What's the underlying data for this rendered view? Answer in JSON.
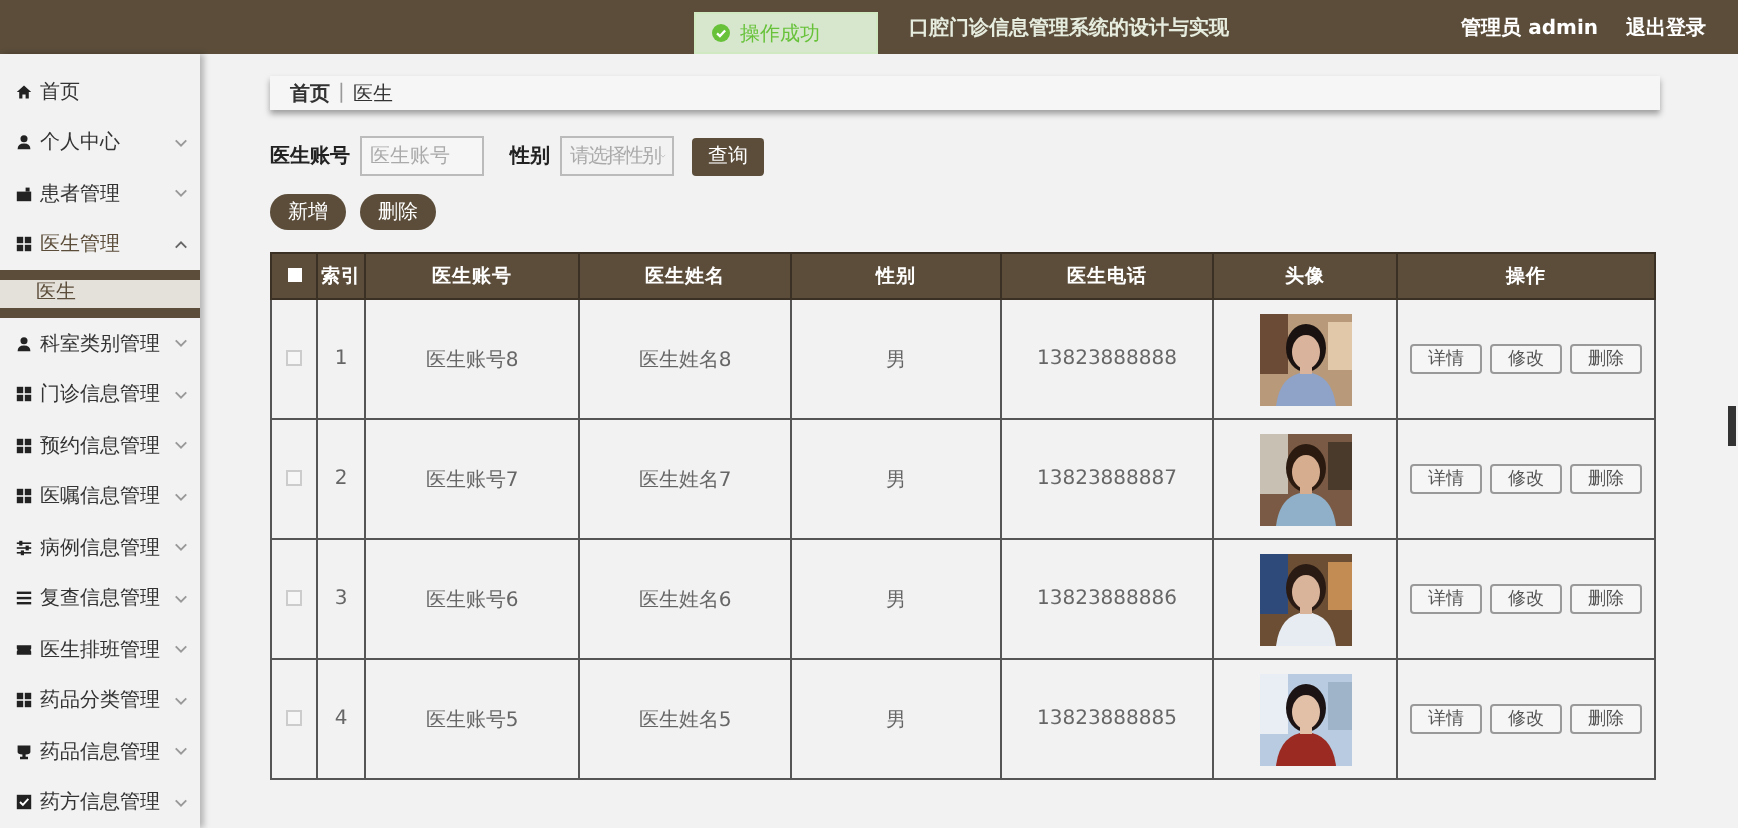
{
  "header": {
    "title": "口腔门诊信息管理系统的设计与实现",
    "user": "管理员 admin",
    "logout": "退出登录"
  },
  "toast": {
    "message": "操作成功"
  },
  "sidebar": {
    "items": [
      {
        "label": "首页",
        "kind": "link"
      },
      {
        "label": "个人中心",
        "kind": "menu",
        "expanded": false
      },
      {
        "label": "患者管理",
        "kind": "menu",
        "expanded": false
      },
      {
        "label": "医生管理",
        "kind": "menu",
        "expanded": true,
        "children": [
          {
            "label": "医生",
            "selected": true
          }
        ]
      },
      {
        "label": "科室类别管理",
        "kind": "menu",
        "expanded": false
      },
      {
        "label": "门诊信息管理",
        "kind": "menu",
        "expanded": false
      },
      {
        "label": "预约信息管理",
        "kind": "menu",
        "expanded": false
      },
      {
        "label": "医嘱信息管理",
        "kind": "menu",
        "expanded": false
      },
      {
        "label": "病例信息管理",
        "kind": "menu",
        "expanded": false
      },
      {
        "label": "复查信息管理",
        "kind": "menu",
        "expanded": false
      },
      {
        "label": "医生排班管理",
        "kind": "menu",
        "expanded": false
      },
      {
        "label": "药品分类管理",
        "kind": "menu",
        "expanded": false
      },
      {
        "label": "药品信息管理",
        "kind": "menu",
        "expanded": false
      },
      {
        "label": "药方信息管理",
        "kind": "menu",
        "expanded": false
      }
    ]
  },
  "breadcrumb": {
    "items": [
      "首页",
      "医生"
    ],
    "separator": "|"
  },
  "search": {
    "fields": [
      {
        "label": "医生账号",
        "placeholder": "医生账号",
        "kind": "input"
      },
      {
        "label": "性别",
        "placeholder": "请选择性别",
        "kind": "select"
      }
    ],
    "button": "查询"
  },
  "toolbar": [
    "新增",
    "删除"
  ],
  "table": {
    "header_checkbox": {
      "checked": false
    },
    "columns": [
      "索引",
      "医生账号",
      "医生姓名",
      "性别",
      "医生电话",
      "头像",
      "操作"
    ],
    "rows": [
      {
        "checked": false,
        "index": "1",
        "account": "医生账号8",
        "name": "医生姓名8",
        "gender": "男",
        "phone": "13823888888",
        "avatar": {
          "kind": "picture"
        },
        "actions": [
          "详情",
          "修改",
          "删除"
        ]
      },
      {
        "checked": false,
        "index": "2",
        "account": "医生账号7",
        "name": "医生姓名7",
        "gender": "男",
        "phone": "13823888887",
        "avatar": {
          "kind": "picture"
        },
        "actions": [
          "详情",
          "修改",
          "删除"
        ]
      },
      {
        "checked": false,
        "index": "3",
        "account": "医生账号6",
        "name": "医生姓名6",
        "gender": "男",
        "phone": "13823888886",
        "avatar": {
          "kind": "picture"
        },
        "actions": [
          "详情",
          "修改",
          "删除"
        ]
      },
      {
        "checked": false,
        "index": "4",
        "account": "医生账号5",
        "name": "医生姓名5",
        "gender": "男",
        "phone": "13823888885",
        "avatar": {
          "kind": "picture"
        },
        "actions": [
          "详情",
          "修改",
          "删除"
        ]
      }
    ]
  }
}
